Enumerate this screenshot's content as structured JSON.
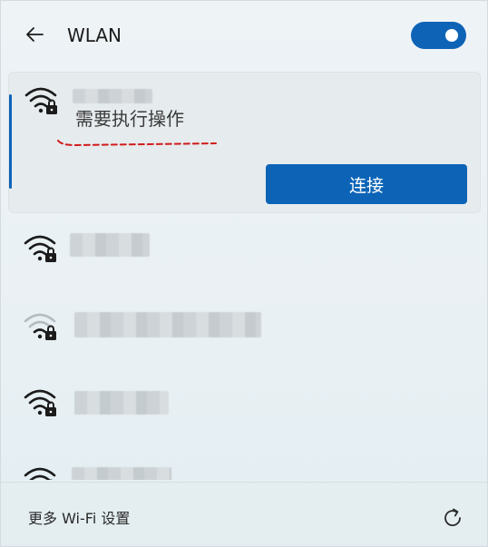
{
  "header": {
    "back_icon": "arrow-left-icon",
    "title": "WLAN",
    "toggle_on": true,
    "accent_color": "#0e63b6"
  },
  "networks": [
    {
      "secured": true,
      "signal": "full",
      "status": "需要执行操作",
      "connect_label": "连接",
      "selected": true
    },
    {
      "secured": true,
      "signal": "full",
      "selected": false
    },
    {
      "secured": true,
      "signal": "weak",
      "selected": false
    },
    {
      "secured": true,
      "signal": "full",
      "selected": false
    },
    {
      "secured": true,
      "signal": "full",
      "selected": false
    }
  ],
  "annotation_color": "#d11a1a",
  "footer": {
    "more_settings_label": "更多 Wi-Fi 设置",
    "refresh_icon": "refresh-icon"
  }
}
